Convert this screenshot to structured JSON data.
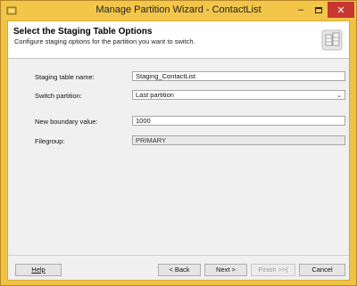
{
  "window": {
    "title": "Manage Partition Wizard - ContactList",
    "controls": {
      "minimize": "–",
      "close": "✕"
    }
  },
  "header": {
    "title": "Select the Staging Table Options",
    "subtitle": "Configure staging options for the partition you want to switch."
  },
  "form": {
    "staging_table": {
      "label": "Staging table name:",
      "value": "Staging_ContactList"
    },
    "switch_partition": {
      "label": "Switch partition:",
      "value": "Last partition"
    },
    "boundary": {
      "label": "New boundary value:",
      "value": "1000"
    },
    "filegroup": {
      "label": "Filegroup:",
      "value": "PRIMARY"
    }
  },
  "footer": {
    "help": "Help",
    "back": "< Back",
    "next": "Next >",
    "finish": "Finish >>|",
    "cancel": "Cancel"
  },
  "icons": {
    "app": "sql-server-icon",
    "header_art": "partition-wizard-icon",
    "dropdown": "chevron-down-icon"
  },
  "colors": {
    "title_bar": "#f3c64a",
    "close_button": "#c7372f"
  }
}
